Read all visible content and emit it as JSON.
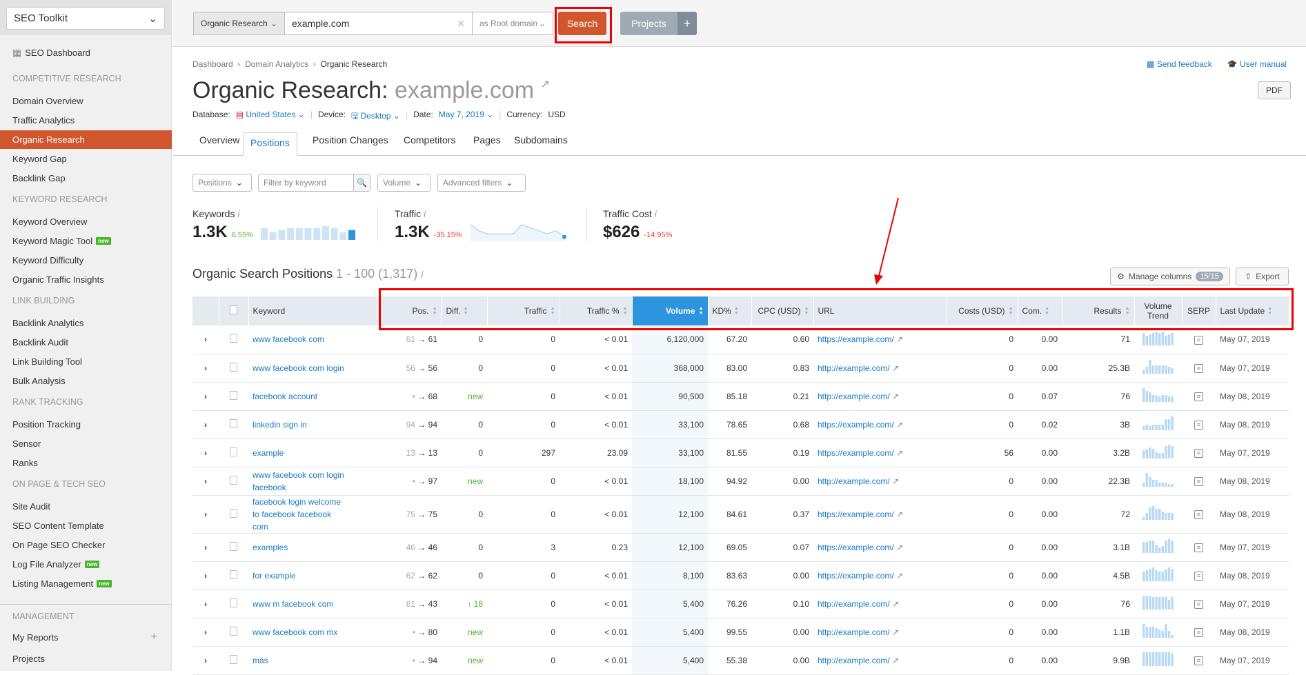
{
  "sidebar": {
    "toolkit": "SEO Toolkit",
    "dashboard": "SEO Dashboard",
    "sections": [
      {
        "title": "Competitive Research",
        "items": [
          {
            "label": "Domain Overview"
          },
          {
            "label": "Traffic Analytics"
          },
          {
            "label": "Organic Research",
            "active": true
          },
          {
            "label": "Keyword Gap"
          },
          {
            "label": "Backlink Gap"
          }
        ]
      },
      {
        "title": "Keyword Research",
        "items": [
          {
            "label": "Keyword Overview"
          },
          {
            "label": "Keyword Magic Tool",
            "badge": "new"
          },
          {
            "label": "Keyword Difficulty"
          },
          {
            "label": "Organic Traffic Insights"
          }
        ]
      },
      {
        "title": "Link Building",
        "items": [
          {
            "label": "Backlink Analytics"
          },
          {
            "label": "Backlink Audit"
          },
          {
            "label": "Link Building Tool"
          },
          {
            "label": "Bulk Analysis"
          }
        ]
      },
      {
        "title": "Rank Tracking",
        "items": [
          {
            "label": "Position Tracking"
          },
          {
            "label": "Sensor"
          },
          {
            "label": "Ranks"
          }
        ]
      },
      {
        "title": "On Page & Tech SEO",
        "items": [
          {
            "label": "Site Audit"
          },
          {
            "label": "SEO Content Template"
          },
          {
            "label": "On Page SEO Checker"
          },
          {
            "label": "Log File Analyzer",
            "badge": "new"
          },
          {
            "label": "Listing Management",
            "badge": "new"
          }
        ]
      }
    ],
    "management": {
      "title": "Management",
      "my_reports": "My Reports",
      "projects": "Projects"
    }
  },
  "search": {
    "type": "Organic Research",
    "query": "example.com",
    "scope": "as Root domain",
    "button": "Search",
    "projects": "Projects"
  },
  "breadcrumb": [
    "Dashboard",
    "Domain Analytics",
    "Organic Research"
  ],
  "header": {
    "title": "Organic Research:",
    "domain": "example.com",
    "send_feedback": "Send feedback",
    "user_manual": "User manual",
    "pdf": "PDF",
    "database_label": "Database:",
    "database": "United States",
    "device_label": "Device:",
    "device": "Desktop",
    "date_label": "Date:",
    "date": "May 7, 2019",
    "currency_label": "Currency:",
    "currency": "USD"
  },
  "tabs": [
    "Overview",
    "Positions",
    "Position Changes",
    "Competitors",
    "Pages",
    "Subdomains"
  ],
  "active_tab": "Positions",
  "filters": {
    "positions": "Positions",
    "keyword_placeholder": "Filter by keyword",
    "volume": "Volume",
    "advanced": "Advanced filters"
  },
  "stats": {
    "keywords": {
      "label": "Keywords",
      "value": "1.3K",
      "delta": "6.55%",
      "trend": [
        6,
        4,
        5,
        6,
        6,
        6,
        6,
        7,
        6,
        4,
        5
      ]
    },
    "traffic": {
      "label": "Traffic",
      "value": "1.3K",
      "delta": "-35.15%",
      "trend": [
        5,
        3,
        2,
        2,
        2,
        2,
        5,
        4,
        3,
        2,
        3,
        1
      ]
    },
    "cost": {
      "label": "Traffic Cost",
      "value": "$626",
      "delta": "-14.95%"
    }
  },
  "colors": {
    "accent": "#d0562e",
    "link": "#1a7ac0",
    "positive": "#4ab629",
    "negative": "#e53935",
    "sorted": "#2d94e0"
  },
  "table": {
    "title": "Organic Search Positions",
    "range": "1 - 100 (1,317)",
    "manage_columns": "Manage columns",
    "columns_count": "15/15",
    "export": "Export",
    "columns": [
      "Keyword",
      "Pos.",
      "Diff.",
      "Traffic",
      "Traffic %",
      "Volume",
      "KD%",
      "CPC (USD)",
      "URL",
      "Costs (USD)",
      "Com.",
      "Results",
      "Volume Trend",
      "SERP",
      "Last Update"
    ],
    "rows": [
      {
        "keyword": "www facebook com",
        "prev": "61",
        "pos": "61",
        "diff": "0",
        "traffic": "0",
        "traffic_pct": "< 0.01",
        "volume": "6,120,000",
        "kd": "67.20",
        "cpc": "0.60",
        "url": "https://example.com/",
        "costs": "0",
        "com": "0.00",
        "results": "71",
        "trend": [
          9,
          7,
          8,
          9,
          10,
          9,
          10,
          7,
          8,
          9
        ],
        "updated": "May 07, 2019"
      },
      {
        "keyword": "www facebook com login",
        "prev": "56",
        "pos": "56",
        "diff": "0",
        "traffic": "0",
        "traffic_pct": "< 0.01",
        "volume": "368,000",
        "kd": "83.00",
        "cpc": "0.83",
        "url": "http://example.com/",
        "costs": "0",
        "com": "0.00",
        "results": "25.3B",
        "trend": [
          3,
          5,
          10,
          6,
          6,
          6,
          6,
          6,
          5,
          4
        ],
        "updated": "May 07, 2019"
      },
      {
        "keyword": "facebook account",
        "prev": "•",
        "pos": "68",
        "diff": "new",
        "traffic": "0",
        "traffic_pct": "< 0.01",
        "volume": "90,500",
        "kd": "85.18",
        "cpc": "0.21",
        "url": "http://example.com/",
        "costs": "0",
        "com": "0.07",
        "results": "76",
        "trend": [
          10,
          8,
          7,
          5,
          5,
          4,
          5,
          5,
          4,
          4
        ],
        "updated": "May 08, 2019"
      },
      {
        "keyword": "linkedin sign in",
        "prev": "94",
        "pos": "94",
        "diff": "0",
        "traffic": "0",
        "traffic_pct": "< 0.01",
        "volume": "33,100",
        "kd": "78.65",
        "cpc": "0.68",
        "url": "https://example.com/",
        "costs": "0",
        "com": "0.02",
        "results": "3B",
        "trend": [
          3,
          4,
          3,
          4,
          4,
          4,
          4,
          8,
          8,
          10
        ],
        "updated": "May 08, 2019"
      },
      {
        "keyword": "example",
        "prev": "13",
        "pos": "13",
        "diff": "0",
        "traffic": "297",
        "traffic_pct": "23.09",
        "volume": "33,100",
        "kd": "81.55",
        "cpc": "0.19",
        "url": "https://example.com/",
        "costs": "56",
        "com": "0.00",
        "results": "3.2B",
        "trend": [
          6,
          7,
          8,
          7,
          5,
          4,
          4,
          9,
          10,
          9
        ],
        "updated": "May 07, 2019"
      },
      {
        "keyword": "www facebook com login facebook",
        "prev": "•",
        "pos": "97",
        "diff": "new",
        "traffic": "0",
        "traffic_pct": "< 0.01",
        "volume": "18,100",
        "kd": "94.92",
        "cpc": "0.00",
        "url": "http://example.com/",
        "costs": "0",
        "com": "0.00",
        "results": "22.3B",
        "trend": [
          3,
          10,
          7,
          5,
          5,
          3,
          3,
          3,
          2,
          2
        ],
        "updated": "May 08, 2019"
      },
      {
        "keyword": "facebook login welcome to facebook facebook com",
        "prev": "75",
        "pos": "75",
        "diff": "0",
        "traffic": "0",
        "traffic_pct": "< 0.01",
        "volume": "12,100",
        "kd": "84.61",
        "cpc": "0.37",
        "url": "https://example.com/",
        "costs": "0",
        "com": "0.00",
        "results": "72",
        "trend": [
          2,
          5,
          9,
          10,
          8,
          8,
          6,
          5,
          5,
          5
        ],
        "updated": "May 08, 2019"
      },
      {
        "keyword": "examples",
        "prev": "46",
        "pos": "46",
        "diff": "0",
        "traffic": "3",
        "traffic_pct": "0.23",
        "volume": "12,100",
        "kd": "69.05",
        "cpc": "0.07",
        "url": "https://example.com/",
        "costs": "0",
        "com": "0.00",
        "results": "3.1B",
        "trend": [
          8,
          8,
          9,
          9,
          6,
          4,
          5,
          9,
          10,
          9
        ],
        "updated": "May 07, 2019"
      },
      {
        "keyword": "for example",
        "prev": "62",
        "pos": "62",
        "diff": "0",
        "traffic": "0",
        "traffic_pct": "< 0.01",
        "volume": "8,100",
        "kd": "83.63",
        "cpc": "0.00",
        "url": "https://example.com/",
        "costs": "0",
        "com": "0.00",
        "results": "4.5B",
        "trend": [
          7,
          8,
          9,
          10,
          8,
          7,
          7,
          9,
          10,
          9
        ],
        "updated": "May 08, 2019"
      },
      {
        "keyword": "www m facebook com",
        "prev": "61",
        "pos": "43",
        "diff": "↑ 18",
        "traffic": "0",
        "traffic_pct": "< 0.01",
        "volume": "5,400",
        "kd": "76.26",
        "cpc": "0.10",
        "url": "http://example.com/",
        "costs": "0",
        "com": "0.00",
        "results": "76",
        "trend": [
          10,
          10,
          10,
          9,
          9,
          9,
          9,
          9,
          7,
          9
        ],
        "updated": "May 07, 2019"
      },
      {
        "keyword": "www facebook com mx",
        "prev": "•",
        "pos": "80",
        "diff": "new",
        "traffic": "0",
        "traffic_pct": "< 0.01",
        "volume": "5,400",
        "kd": "99.55",
        "cpc": "0.00",
        "url": "http://example.com/",
        "costs": "0",
        "com": "0.00",
        "results": "1.1B",
        "trend": [
          10,
          8,
          8,
          8,
          7,
          6,
          5,
          10,
          5,
          2
        ],
        "updated": "May 08, 2019"
      },
      {
        "keyword": "más",
        "prev": "•",
        "pos": "94",
        "diff": "new",
        "traffic": "0",
        "traffic_pct": "< 0.01",
        "volume": "5,400",
        "kd": "55.38",
        "cpc": "0.00",
        "url": "http://example.com/",
        "costs": "0",
        "com": "0.00",
        "results": "9.9B",
        "trend": [
          10,
          10,
          10,
          10,
          10,
          10,
          10,
          10,
          10,
          9
        ],
        "updated": "May 07, 2019"
      }
    ]
  }
}
